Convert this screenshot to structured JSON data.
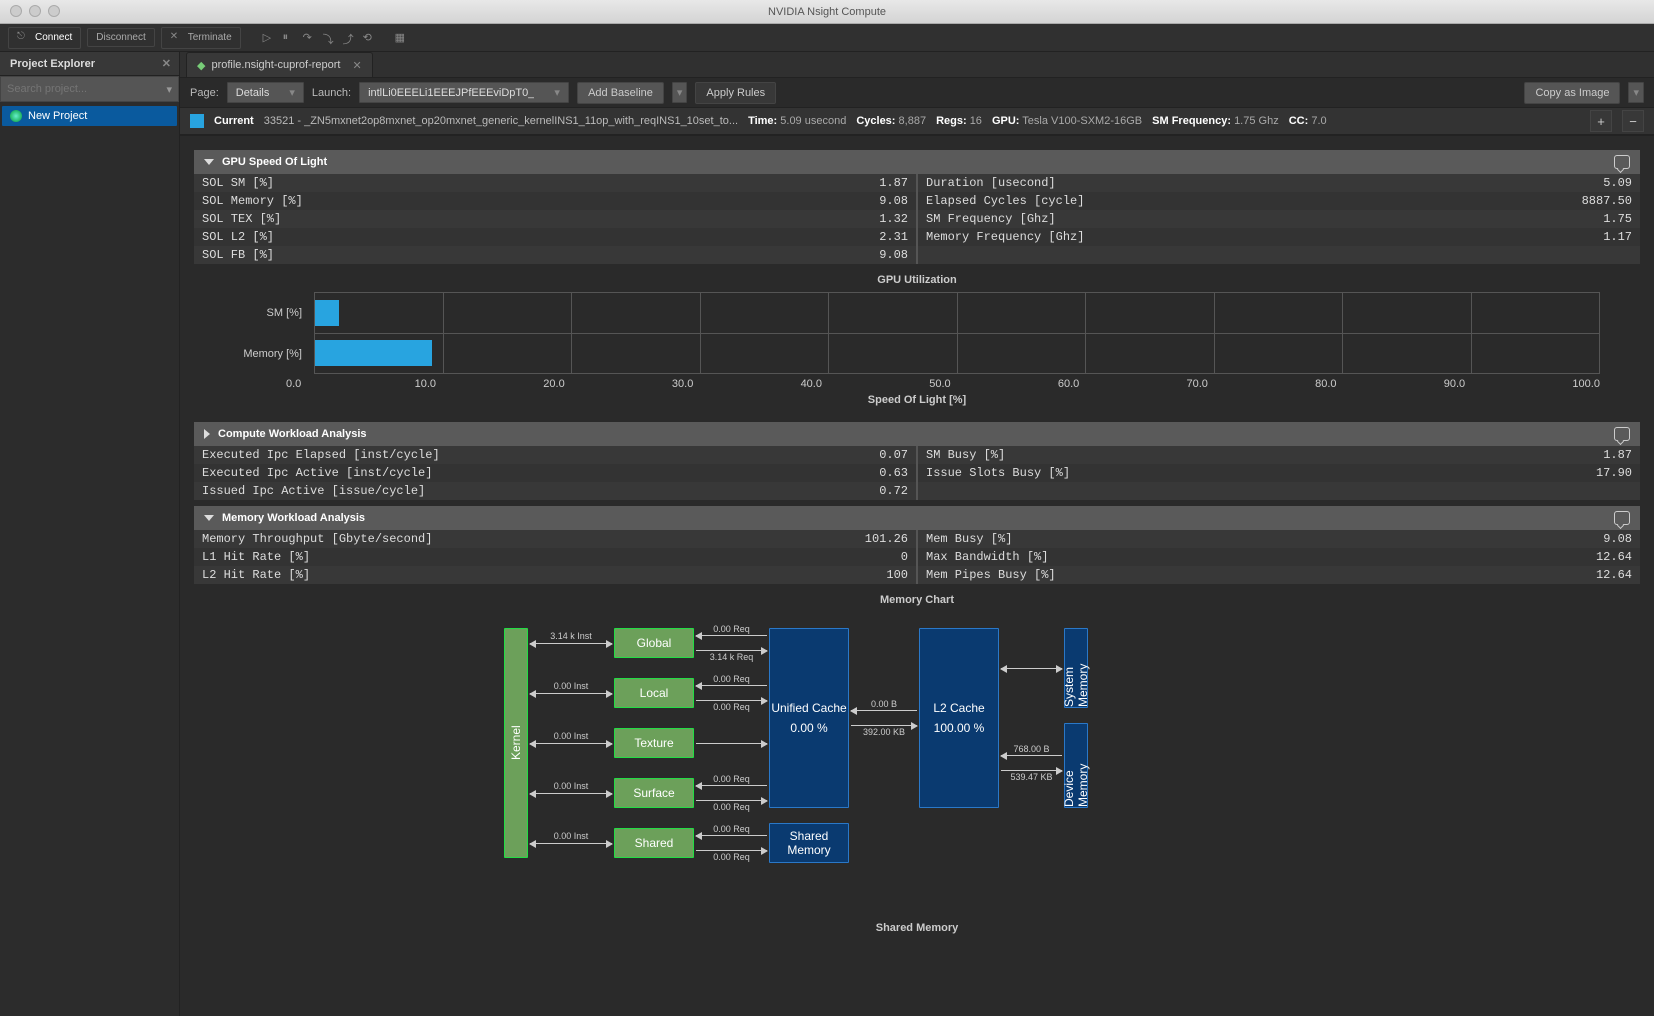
{
  "app_title": "NVIDIA Nsight Compute",
  "toolbar": {
    "connect": "Connect",
    "disconnect": "Disconnect",
    "terminate": "Terminate"
  },
  "sidebar": {
    "title": "Project Explorer",
    "search_placeholder": "Search project...",
    "item": "New Project"
  },
  "tab": {
    "name": "profile.nsight-cuprof-report"
  },
  "subtoolbar": {
    "page_label": "Page:",
    "page_value": "Details",
    "launch_label": "Launch:",
    "launch_value": "intlLi0EEELi1EEEJPfEEEviDpT0_",
    "add_baseline": "Add Baseline",
    "apply_rules": "Apply Rules",
    "copy_image": "Copy as Image"
  },
  "current": {
    "label": "Current",
    "kernel": "33521 - _ZN5mxnet2op8mxnet_op20mxnet_generic_kernelINS1_11op_with_reqINS1_10set_to...",
    "time_label": "Time:",
    "time": "5.09 usecond",
    "cycles_label": "Cycles:",
    "cycles": "8,887",
    "regs_label": "Regs:",
    "regs": "16",
    "gpu_label": "GPU:",
    "gpu": "Tesla V100-SXM2-16GB",
    "smfreq_label": "SM Frequency:",
    "smfreq": "1.75 Ghz",
    "cc_label": "CC:",
    "cc": "7.0"
  },
  "sections": {
    "sol": {
      "title": "GPU Speed Of Light",
      "left": [
        {
          "n": "SOL SM [%]",
          "v": "1.87"
        },
        {
          "n": "SOL Memory [%]",
          "v": "9.08"
        },
        {
          "n": "SOL TEX [%]",
          "v": "1.32"
        },
        {
          "n": "SOL L2 [%]",
          "v": "2.31"
        },
        {
          "n": "SOL FB [%]",
          "v": "9.08"
        }
      ],
      "right": [
        {
          "n": "Duration [usecond]",
          "v": "5.09"
        },
        {
          "n": "Elapsed Cycles [cycle]",
          "v": "8887.50"
        },
        {
          "n": "SM Frequency [Ghz]",
          "v": "1.75"
        },
        {
          "n": "Memory Frequency [Ghz]",
          "v": "1.17"
        }
      ],
      "chart_title": "GPU Utilization",
      "xaxis_title": "Speed Of Light [%]"
    },
    "compute": {
      "title": "Compute Workload Analysis",
      "left": [
        {
          "n": "Executed Ipc Elapsed [inst/cycle]",
          "v": "0.07"
        },
        {
          "n": "Executed Ipc Active [inst/cycle]",
          "v": "0.63"
        },
        {
          "n": "Issued Ipc Active [issue/cycle]",
          "v": "0.72"
        }
      ],
      "right": [
        {
          "n": "SM Busy [%]",
          "v": "1.87"
        },
        {
          "n": "Issue Slots Busy [%]",
          "v": "17.90"
        }
      ]
    },
    "memory": {
      "title": "Memory Workload Analysis",
      "left": [
        {
          "n": "Memory Throughput [Gbyte/second]",
          "v": "101.26"
        },
        {
          "n": "L1 Hit Rate [%]",
          "v": "0"
        },
        {
          "n": "L2 Hit Rate [%]",
          "v": "100"
        }
      ],
      "right": [
        {
          "n": "Mem Busy [%]",
          "v": "9.08"
        },
        {
          "n": "Max Bandwidth [%]",
          "v": "12.64"
        },
        {
          "n": "Mem Pipes Busy [%]",
          "v": "12.64"
        }
      ],
      "chart_title": "Memory Chart",
      "footer": "Shared Memory"
    }
  },
  "chart_data": {
    "type": "bar",
    "title": "GPU Utilization",
    "categories": [
      "SM [%]",
      "Memory [%]"
    ],
    "values": [
      1.87,
      9.08
    ],
    "xlabel": "Speed Of Light [%]",
    "ylabel": "",
    "xlim": [
      0,
      100
    ],
    "ticks": [
      "0.0",
      "10.0",
      "20.0",
      "30.0",
      "40.0",
      "50.0",
      "60.0",
      "70.0",
      "80.0",
      "90.0",
      "100.0"
    ]
  },
  "mem_diagram": {
    "kernel": "Kernel",
    "global": "Global",
    "local": "Local",
    "texture": "Texture",
    "surface": "Surface",
    "shared": "Shared",
    "unified_t": "Unified Cache",
    "unified_v": "0.00 %",
    "l2_t": "L2 Cache",
    "l2_v": "100.00 %",
    "shared_mem": "Shared Memory",
    "sys_mem": "System Memory",
    "dev_mem": "Device Memory",
    "kinst314": "3.14 k Inst",
    "inst0": "0.00 Inst",
    "req314": "3.14 k Req",
    "req0": "0.00 Req",
    "b0": "0.00 B",
    "kb392": "392.00 KB",
    "b768": "768.00 B",
    "kb539": "539.47 KB"
  }
}
